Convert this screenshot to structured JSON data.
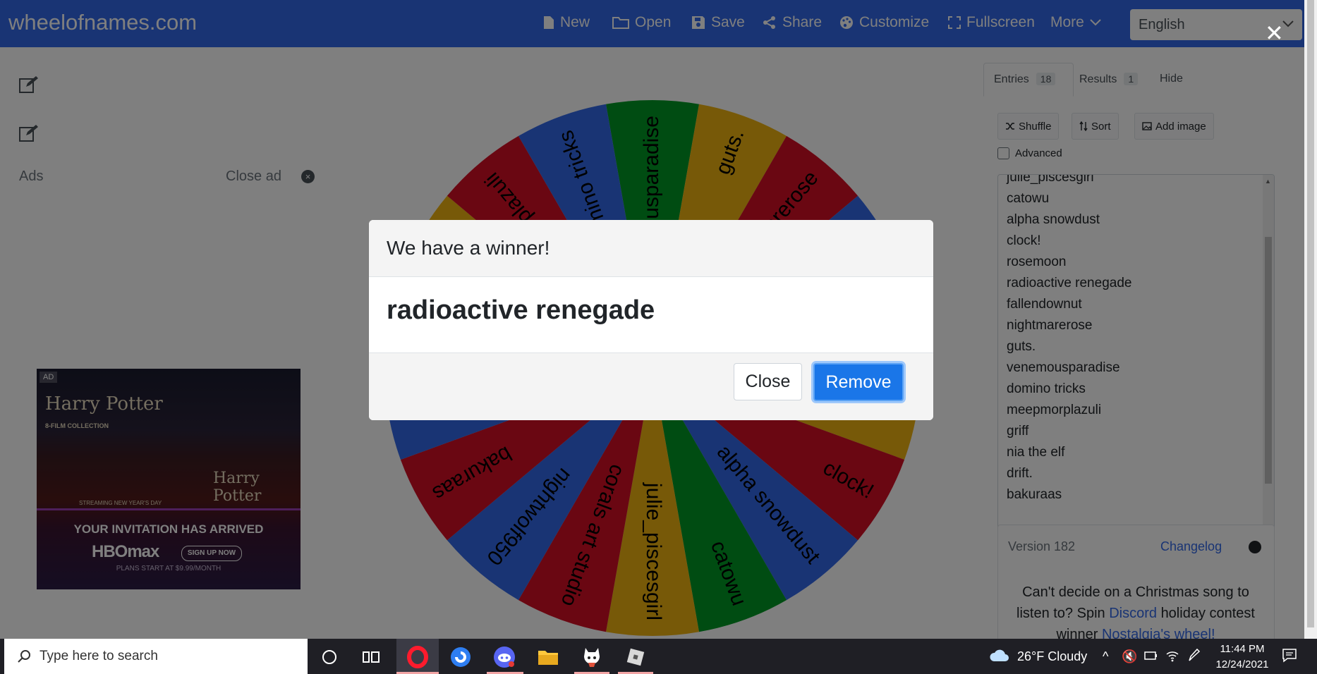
{
  "navbar": {
    "brand": "wheelofnames.com",
    "items": [
      "New",
      "Open",
      "Save",
      "Share",
      "Customize",
      "Fullscreen",
      "More"
    ],
    "language": "English"
  },
  "left": {
    "ads_label": "Ads",
    "close_ad": "Close ad"
  },
  "ad": {
    "badge": "AD",
    "title": "Harry Potter",
    "subtitle": "8-FILM COLLECTION",
    "title2": "Harry Potter",
    "streaming": "STREAMING NEW YEAR'S DAY",
    "headline": "YOUR INVITATION HAS ARRIVED",
    "logo": "HBOmax",
    "cta": "SIGN UP NOW",
    "fineprint": "PLANS START AT $9.99/MONTH"
  },
  "wheel": {
    "segments": [
      {
        "label": "venemousparadise",
        "color": "#009925"
      },
      {
        "label": "guts.",
        "color": "#EEB211"
      },
      {
        "label": "nightmarerose",
        "color": "#D50F25"
      },
      {
        "label": "fallendownut",
        "color": "#3369E8"
      },
      {
        "label": "radioactive renegade",
        "color": "#009925"
      },
      {
        "label": "rosemoon",
        "color": "#EEB211"
      },
      {
        "label": "clock!",
        "color": "#D50F25"
      },
      {
        "label": "alpha snowdust",
        "color": "#3369E8"
      },
      {
        "label": "catowu",
        "color": "#009925"
      },
      {
        "label": "julie_piscesgirl",
        "color": "#EEB211"
      },
      {
        "label": "corals art studio",
        "color": "#D50F25"
      },
      {
        "label": "nightwolf950",
        "color": "#3369E8"
      },
      {
        "label": "bakuraas",
        "color": "#D50F25"
      },
      {
        "label": "drift.",
        "color": "#3369E8"
      },
      {
        "label": "nia the elf",
        "color": "#009925"
      },
      {
        "label": "griff",
        "color": "#EEB211"
      },
      {
        "label": "meepmorplazuli",
        "color": "#D50F25"
      },
      {
        "label": "domino tricks",
        "color": "#3369E8"
      }
    ]
  },
  "panel": {
    "tabs": [
      {
        "label": "Entries",
        "count": "18"
      },
      {
        "label": "Results",
        "count": "1"
      },
      {
        "label": "Hide"
      }
    ],
    "tools": [
      "Shuffle",
      "Sort",
      "Add image"
    ],
    "advanced": "Advanced",
    "entries": [
      "julie_piscesgirl",
      "catowu",
      "alpha snowdust",
      "clock!",
      "rosemoon",
      "radioactive renegade",
      "fallendownut",
      "nightmarerose",
      "guts.",
      "venemousparadise",
      "domino tricks",
      "meepmorplazuli",
      "griff",
      "nia the elf",
      "drift.",
      "bakuraas"
    ],
    "version": "Version 182",
    "changelog": "Changelog",
    "promo_1": "Can't decide on a Christmas song to listen to? Spin",
    "promo_link1": "Discord",
    "promo_2": "holiday contest winner",
    "promo_link2": "Nostalgia's wheel!"
  },
  "modal": {
    "title": "We have a winner!",
    "winner": "radioactive renegade",
    "close_label": "Close",
    "remove_label": "Remove"
  },
  "taskbar": {
    "search_placeholder": "Type here to search",
    "weather": "26°F  Cloudy",
    "time": "11:44 PM",
    "date": "12/24/2021"
  }
}
